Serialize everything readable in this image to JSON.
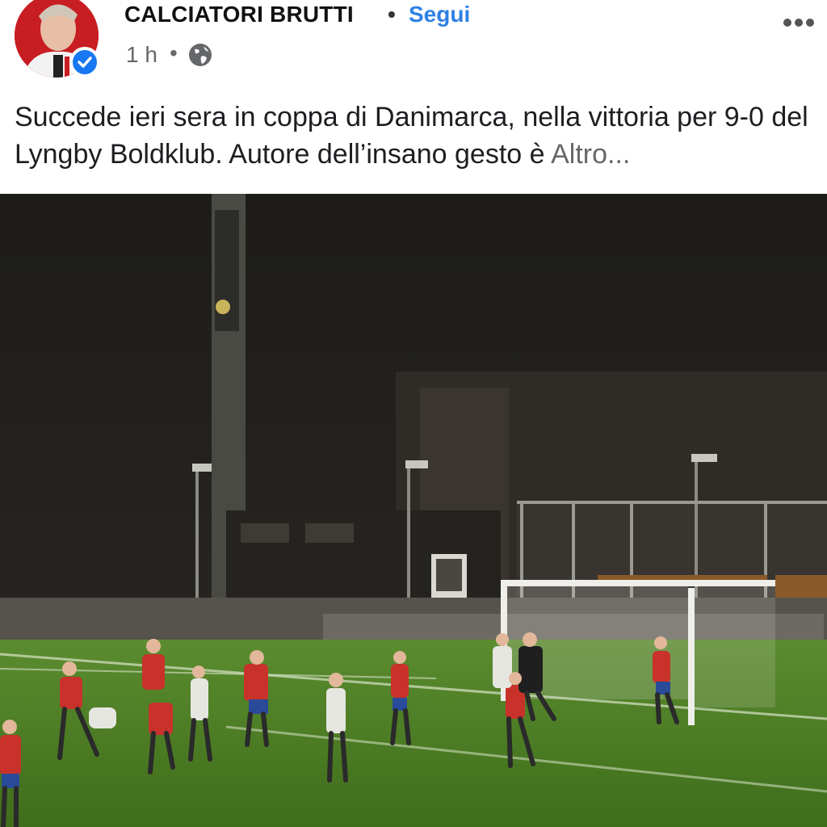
{
  "post": {
    "author": "CALCIATORI BRUTTI",
    "separator": "•",
    "follow_label": "Segui",
    "time": "1 h",
    "meta_separator": "•",
    "privacy_icon": "globe-icon",
    "verified_icon": "verified-check-icon",
    "options_icon": "more-options-icon",
    "caption_text": "Succede ieri sera in coppa di Danimarca, nella vittoria per 9-0 del Lyngby Boldklub. Autore dell’insano gesto è ",
    "caption_more": "Altro..."
  },
  "colors": {
    "follow": "#2e81e4",
    "verified": "#1877f2",
    "meta_gray": "#65676b",
    "pitch_green": "#4c7b24"
  }
}
